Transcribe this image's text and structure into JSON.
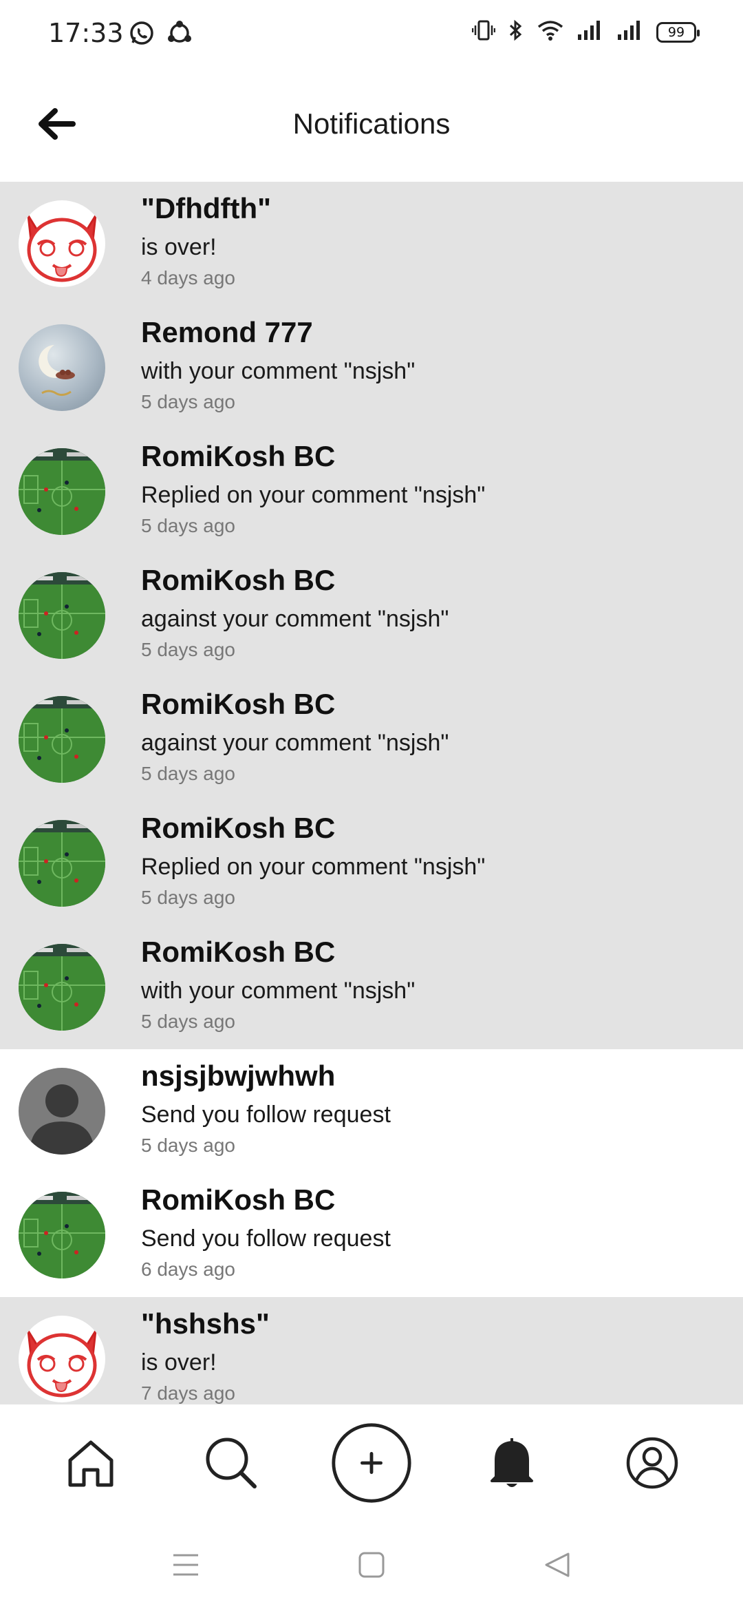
{
  "status_bar": {
    "time": "17:33",
    "battery": "99",
    "icons": [
      "whatsapp-icon",
      "sync-icon",
      "vibrate-icon",
      "bluetooth-icon",
      "wifi-icon",
      "signal-icon",
      "signal-icon",
      "battery-icon"
    ]
  },
  "header": {
    "title": "Notifications",
    "back_icon": "arrow-left-icon"
  },
  "notifications": [
    {
      "name": "\"Dfhdfth\"",
      "message": "is over!",
      "time": "4 days ago",
      "avatar": "cat-mascot",
      "unread": true
    },
    {
      "name": "Remond 777",
      "message": "with your comment \"nsjsh\"",
      "time": "5 days ago",
      "avatar": "moon-image",
      "unread": true
    },
    {
      "name": "RomiKosh BC",
      "message": "Replied on your comment \"nsjsh\"",
      "time": "5 days ago",
      "avatar": "football-image",
      "unread": true
    },
    {
      "name": "RomiKosh BC",
      "message": "against your comment \"nsjsh\"",
      "time": "5 days ago",
      "avatar": "football-image",
      "unread": true
    },
    {
      "name": "RomiKosh BC",
      "message": "against your comment \"nsjsh\"",
      "time": "5 days ago",
      "avatar": "football-image",
      "unread": true
    },
    {
      "name": "RomiKosh BC",
      "message": "Replied on your comment \"nsjsh\"",
      "time": "5 days ago",
      "avatar": "football-image",
      "unread": true
    },
    {
      "name": "RomiKosh BC",
      "message": "with your comment \"nsjsh\"",
      "time": "5 days ago",
      "avatar": "football-image",
      "unread": true
    },
    {
      "name": "nsjsjbwjwhwh",
      "message": "Send you follow request",
      "time": "5 days ago",
      "avatar": "default-user",
      "unread": false
    },
    {
      "name": "RomiKosh BC",
      "message": "Send you follow request",
      "time": "6 days ago",
      "avatar": "football-image",
      "unread": false
    },
    {
      "name": "\"hshshs\"",
      "message": "is over!",
      "time": "7 days ago",
      "avatar": "cat-mascot",
      "unread": true
    }
  ],
  "bottom_nav": [
    {
      "icon": "home-icon"
    },
    {
      "icon": "search-icon"
    },
    {
      "icon": "add-post-icon"
    },
    {
      "icon": "bell-icon",
      "active": true
    },
    {
      "icon": "profile-icon"
    }
  ],
  "system_nav": [
    "menu-icon",
    "home-square-icon",
    "back-triangle-icon"
  ],
  "colors": {
    "unread_bg": "#e3e3e3",
    "read_bg": "#ffffff",
    "time_text": "#777777"
  }
}
